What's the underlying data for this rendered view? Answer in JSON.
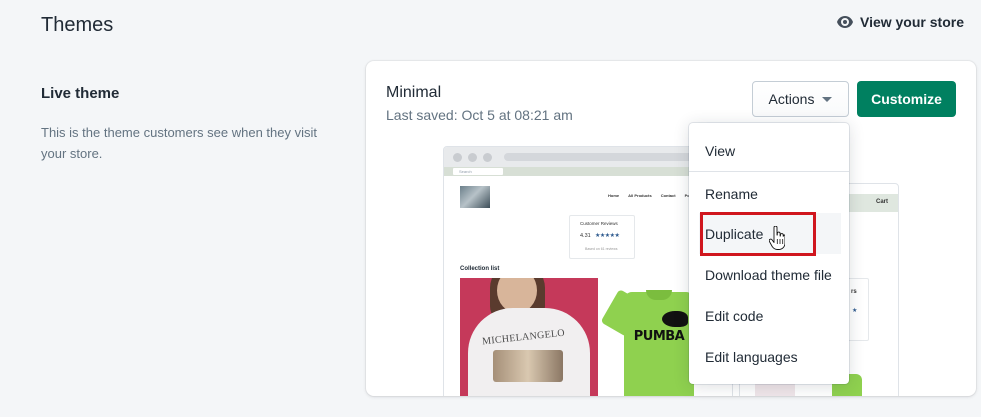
{
  "header": {
    "title": "Themes",
    "view_store_label": "View your store",
    "view_store_icon": "eye-icon"
  },
  "live_theme": {
    "title": "Live theme",
    "description": "This is the theme customers see when they visit your store."
  },
  "theme_card": {
    "name": "Minimal",
    "last_saved": "Last saved: Oct 5 at 08:21 am",
    "actions_label": "Actions",
    "customize_label": "Customize",
    "accent_color": "#008060"
  },
  "preview": {
    "search_placeholder": "Search",
    "nav": [
      "Home",
      "All Products",
      "Contact",
      "Pol"
    ],
    "reviews_title": "Customer Reviews",
    "reviews_score": "4.31",
    "reviews_stars": "★★★★★",
    "reviews_count": "Based on 61 reviews",
    "collection_title": "Collection list",
    "shirt_text_1": "MICHELANGELO",
    "shirt_text_2": "PUMBA",
    "cart_label": "Cart",
    "side_text": "rs",
    "side_star": "★"
  },
  "dropdown": {
    "items": [
      {
        "label": "View"
      },
      {
        "label": "Rename"
      },
      {
        "label": "Duplicate"
      },
      {
        "label": "Download theme file"
      },
      {
        "label": "Edit code"
      },
      {
        "label": "Edit languages"
      }
    ],
    "highlight_color": "#d0161e"
  }
}
